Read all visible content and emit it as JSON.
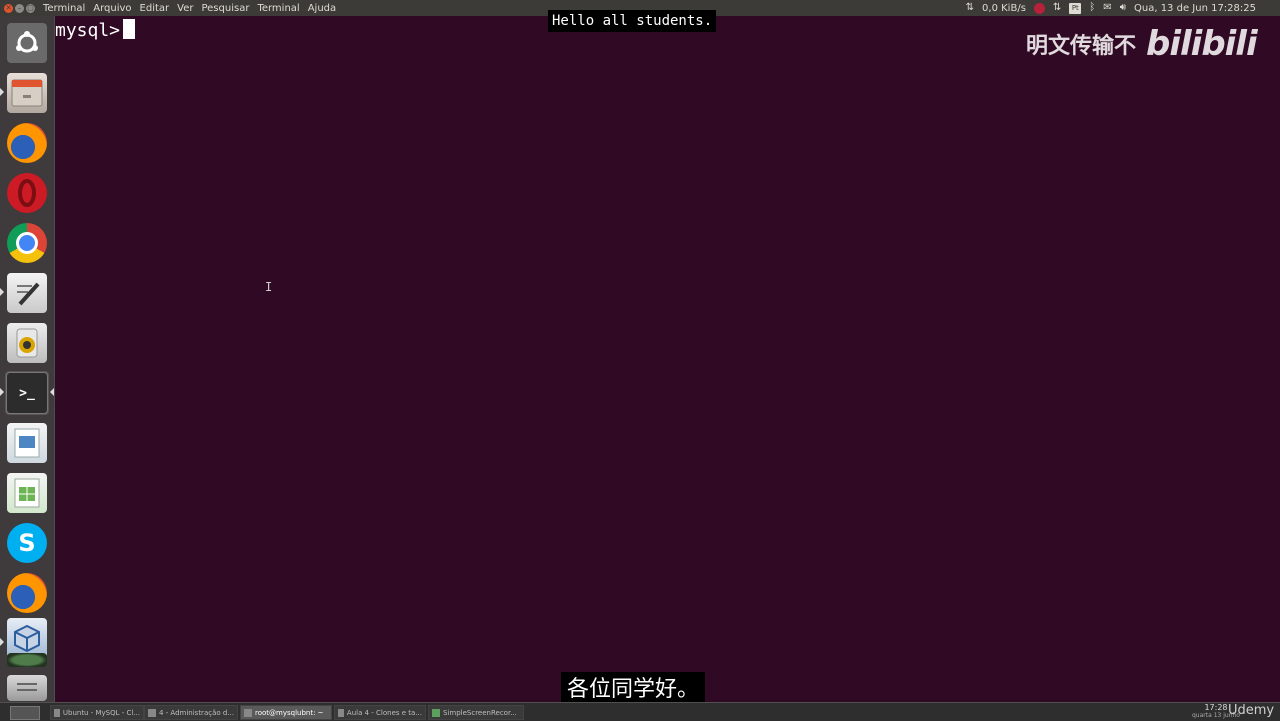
{
  "top_panel": {
    "menu": [
      "Terminal",
      "Arquivo",
      "Editar",
      "Ver",
      "Pesquisar",
      "Terminal",
      "Ajuda"
    ],
    "net_speed": "0,0 KiB/s",
    "datetime": "Qua, 13 de Jun 17:28:25",
    "tray_box_label": "Pt"
  },
  "launcher": {
    "items": [
      "ubuntu-dash",
      "files",
      "firefox",
      "opera",
      "chrome",
      "text-editor",
      "rhythmbox",
      "terminal",
      "libreoffice-impress",
      "libreoffice-calc",
      "skype",
      "firefox-2",
      "virtualbox",
      "workspace-switcher",
      "trash"
    ]
  },
  "terminal": {
    "prompt": "mysql>"
  },
  "subtitles": {
    "english": "Hello all students.",
    "chinese": "各位同学好。"
  },
  "watermark": {
    "text": "明文传输不",
    "logo": "bilibili"
  },
  "taskbar": {
    "tasks": [
      "Ubuntu - MySQL - Cl...",
      "4 - Administração d...",
      "root@mysqlubnt: ~",
      "Aula 4 - Clones e ta...",
      "SimpleScreenRecor..."
    ],
    "clock_time": "17:28",
    "clock_date": "quarta 13 junho",
    "brand": "Udemy"
  },
  "colors": {
    "terminal_bg": "#300a24",
    "panel_bg": "#3c3b37",
    "launcher_bg": "#3f3a3c"
  }
}
